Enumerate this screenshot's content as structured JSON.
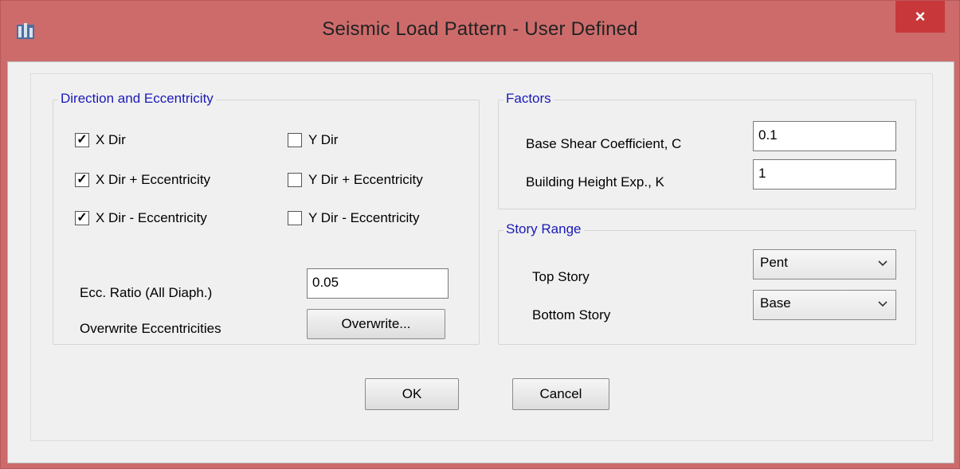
{
  "window": {
    "title": "Seismic Load Pattern - User Defined",
    "close_glyph": "×",
    "colors": {
      "titlebar": "#cd6b6b",
      "close": "#c8383a",
      "group_label": "#1a1ab8"
    }
  },
  "direction": {
    "group_label": "Direction and Eccentricity",
    "checks": [
      {
        "label": "X Dir",
        "checked": true
      },
      {
        "label": "Y Dir",
        "checked": false
      },
      {
        "label": "X Dir + Eccentricity",
        "checked": true
      },
      {
        "label": "Y Dir + Eccentricity",
        "checked": false
      },
      {
        "label": "X Dir - Eccentricity",
        "checked": true
      },
      {
        "label": "Y Dir - Eccentricity",
        "checked": false
      }
    ],
    "ecc_ratio_label": "Ecc. Ratio (All Diaph.)",
    "ecc_ratio_value": "0.05",
    "overwrite_label": "Overwrite Eccentricities",
    "overwrite_button": "Overwrite..."
  },
  "factors": {
    "group_label": "Factors",
    "base_shear_label": "Base Shear Coefficient, C",
    "base_shear_value": "0.1",
    "height_exp_label": "Building Height Exp., K",
    "height_exp_value": "1"
  },
  "story_range": {
    "group_label": "Story Range",
    "top_label": "Top Story",
    "top_value": "Pent",
    "bottom_label": "Bottom Story",
    "bottom_value": "Base"
  },
  "buttons": {
    "ok": "OK",
    "cancel": "Cancel"
  },
  "icons": {
    "app": "etabs-app-icon",
    "dropdown": "chevron-down-icon",
    "check": "check-icon"
  }
}
